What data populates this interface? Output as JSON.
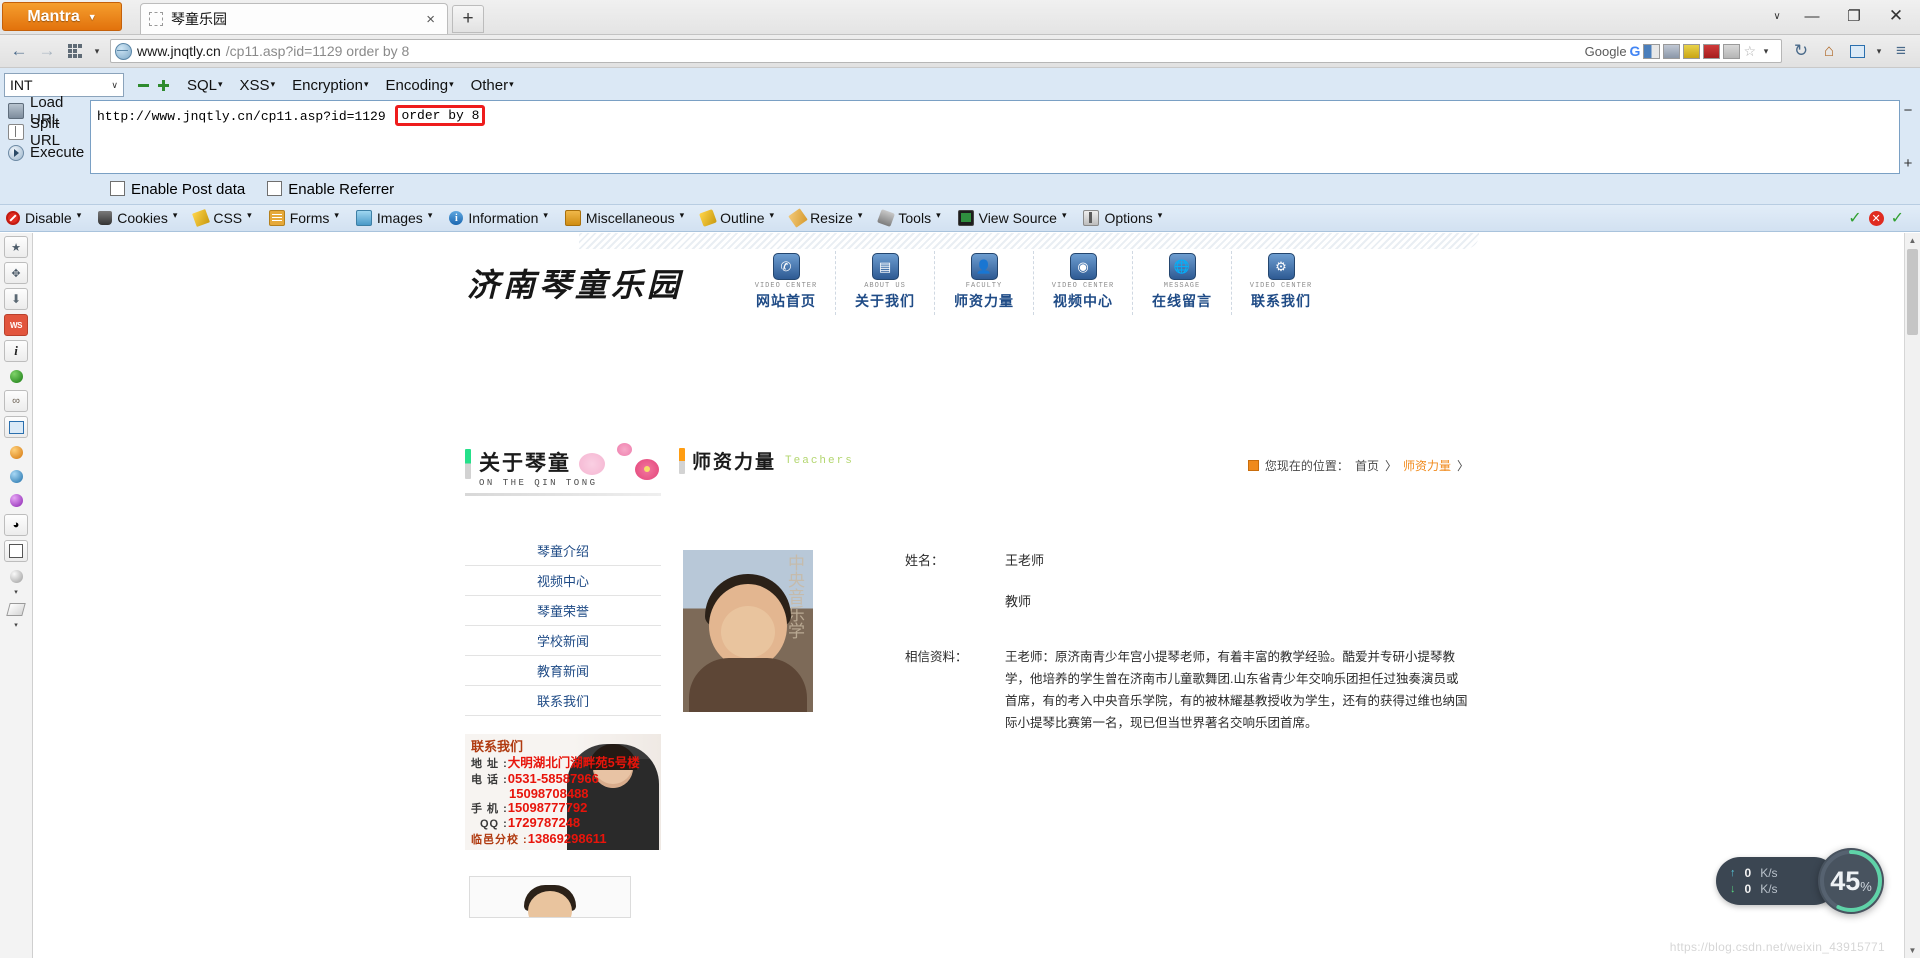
{
  "window": {
    "mantra_label": "Mantra",
    "mantra_caret": "▼",
    "tab_title": "琴童乐园",
    "tab_close": "×",
    "newtab_label": "+",
    "controls": {
      "caret": "∨",
      "minimize": "—",
      "maximize": "❐",
      "close": "✕"
    }
  },
  "navbar": {
    "back": "←",
    "forward": "→",
    "dropdown_caret": "▾",
    "url_domain": "www.jnqtly.cn",
    "url_rest": "/cp11.asp?id=1129 order by 8",
    "search_engine": "Google",
    "search_g": "G",
    "star": "☆",
    "reload": "↻",
    "home": "⌂",
    "panel_caret": "▾",
    "menu": "≡"
  },
  "hackbar": {
    "type_value": "INT",
    "caret": "∨",
    "menus": [
      "SQL",
      "XSS",
      "Encryption",
      "Encoding",
      "Other"
    ],
    "menu_caret": "·",
    "actions": [
      {
        "label": "Lo",
        "accel": "a",
        "rest": "d URL",
        "icon": "load-url-icon"
      },
      {
        "label": "",
        "accel": "S",
        "rest": "plit URL",
        "icon": "split-url-icon"
      },
      {
        "label": "",
        "accel": "E",
        "rest": "xecute",
        "icon": "execute-icon"
      }
    ],
    "action_labels": {
      "load": "Load URL",
      "split": "Split URL",
      "execute": "Execute"
    },
    "textarea_value": "http://www.jnqtly.cn/cp11.asp?id=1129 ",
    "textarea_highlight": "order by 8",
    "right_minus": "−",
    "right_plus": "+",
    "checkbox_post": "Enable Post data",
    "checkbox_referrer": "Enable Referrer"
  },
  "webdev_toolbar": {
    "items": [
      {
        "label": "Disable",
        "icon": "disable-icon"
      },
      {
        "label": "Cookies",
        "icon": "cookies-icon"
      },
      {
        "label": "CSS",
        "icon": "css-icon"
      },
      {
        "label": "Forms",
        "icon": "forms-icon"
      },
      {
        "label": "Images",
        "icon": "images-icon"
      },
      {
        "label": "Information",
        "icon": "information-icon"
      },
      {
        "label": "Miscellaneous",
        "icon": "miscellaneous-icon"
      },
      {
        "label": "Outline",
        "icon": "outline-icon"
      },
      {
        "label": "Resize",
        "icon": "resize-icon"
      },
      {
        "label": "Tools",
        "icon": "tools-icon"
      },
      {
        "label": "View Source",
        "icon": "view-source-icon"
      },
      {
        "label": "Options",
        "icon": "options-icon"
      }
    ],
    "caret": "▾",
    "status": {
      "tick1": "✓",
      "error": "✕",
      "tick2": "✓"
    }
  },
  "vertical_toolbar": {
    "items": [
      {
        "name": "favorites-icon",
        "glyph": "★"
      },
      {
        "name": "puzzle-addon-icon",
        "glyph": "🧩"
      },
      {
        "name": "download-icon",
        "glyph": "⬇"
      },
      {
        "name": "wappalyzer-icon",
        "glyph": "WS"
      },
      {
        "name": "info-italic-icon",
        "glyph": "i"
      },
      {
        "name": "green-ball-icon",
        "glyph": ""
      },
      {
        "name": "glasses-icon",
        "glyph": "∞"
      },
      {
        "name": "select-element-icon",
        "glyph": "↖"
      },
      {
        "name": "orange-badge-icon",
        "glyph": ""
      },
      {
        "name": "seahorse-icon",
        "glyph": ""
      },
      {
        "name": "virus-icon",
        "glyph": ""
      },
      {
        "name": "palette-icon",
        "glyph": ""
      },
      {
        "name": "qr-code-icon",
        "glyph": ""
      },
      {
        "name": "moon-icon",
        "glyph": ""
      },
      {
        "name": "eraser-icon",
        "glyph": ""
      }
    ]
  },
  "site": {
    "logo": "济南琴童乐园",
    "nav": [
      {
        "en": "VIDEO CENTER",
        "cn": "网站首页",
        "icon": "home-nav-icon",
        "glyph": "✆"
      },
      {
        "en": "ABOUT US",
        "cn": "关于我们",
        "icon": "about-nav-icon",
        "glyph": "▤"
      },
      {
        "en": "FACULTY",
        "cn": "师资力量",
        "icon": "faculty-nav-icon",
        "glyph": "👤"
      },
      {
        "en": "VIDEO CENTER",
        "cn": "视频中心",
        "icon": "video-nav-icon",
        "glyph": "◉"
      },
      {
        "en": "MESSAGE",
        "cn": "在线留言",
        "icon": "message-nav-icon",
        "glyph": "🌐"
      },
      {
        "en": "VIDEO CENTER",
        "cn": "联系我们",
        "icon": "contact-nav-icon",
        "glyph": "⚙"
      }
    ],
    "sidebar": {
      "title_cn": "关于琴童",
      "title_en": "ON THE QIN TONG",
      "menu": [
        "琴童介绍",
        "视频中心",
        "琴童荣誉",
        "学校新闻",
        "教育新闻",
        "联系我们"
      ],
      "contact": {
        "title": "联系我们",
        "address_key": "地 址 :",
        "address_value": "大明湖北门湖畔苑5号楼",
        "phone_key": "电 话 :",
        "phone_value": "0531-58587966",
        "phone_value2": "15098708488",
        "mobile_key": "手 机 :",
        "mobile_value": "15098777792",
        "qq_key": "QQ :",
        "qq_value": "1729787248",
        "branch_key": "临邑分校 :",
        "branch_value": "13869298611"
      }
    },
    "main": {
      "title_cn": "师资力量",
      "title_en": "Teachers",
      "breadcrumb_prefix": "您现在的位置：",
      "breadcrumb_home": "首页",
      "breadcrumb_sep": "〉",
      "breadcrumb_current": "师资力量",
      "breadcrumb_tail": "〉",
      "teacher": {
        "name_key": "姓名：",
        "name_value": "王老师",
        "role_value": "教师",
        "desc_key": "相信资料：",
        "desc_value": "王老师：原济南青少年宫小提琴老师，有着丰富的教学经验。酷爱并专研小提琴教学，他培养的学生曾在济南市儿童歌舞团.山东省青少年交响乐团担任过独奏演员或首席，有的考入中央音乐学院，有的被林耀基教授收为学生，还有的获得过维也纳国际小提琴比赛第一名，现已但当世界著名交响乐团首席。",
        "photo_bg_text": "中央音乐学"
      }
    },
    "watermark": "https://blog.csdn.net/weixin_43915771"
  },
  "speed_widget": {
    "upload_value": "0",
    "upload_unit": "K/s",
    "download_value": "0",
    "download_unit": "K/s",
    "percent": "45",
    "percent_sign": "%",
    "up_arrow": "↑",
    "down_arrow": "↓",
    "accent": "#5fd3a8"
  },
  "scrollbar": {
    "up": "▲",
    "down": "▼"
  }
}
